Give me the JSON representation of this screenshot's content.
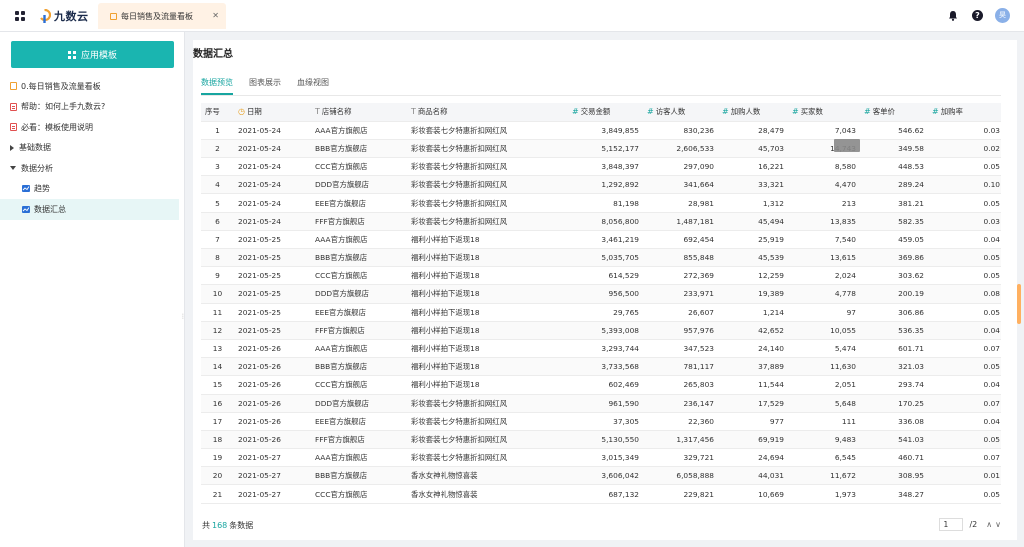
{
  "app": {
    "logo_text": "九数云",
    "tab_title": "每日销售及流量看板",
    "avatar_text": "昊"
  },
  "sidebar": {
    "app_button": "应用模板",
    "items": [
      {
        "label": "0.每日销售及流量看板"
      },
      {
        "label": "帮助：如何上手九数云?"
      },
      {
        "label": "必看：模板使用说明"
      },
      {
        "label": "基础数据"
      },
      {
        "label": "数据分析"
      },
      {
        "label": "趋势"
      },
      {
        "label": "数据汇总"
      }
    ]
  },
  "main": {
    "title": "数据汇总",
    "tabs": [
      "数据预览",
      "图表展示",
      "血缘视图"
    ],
    "columns": [
      "序号",
      "日期",
      "店铺名称",
      "商品名称",
      "交易金额",
      "访客人数",
      "加购人数",
      "买家数",
      "客单价",
      "加购率"
    ],
    "rows": [
      [
        "1",
        "2021-05-24",
        "AAA官方旗舰店",
        "彩妆套装七夕特惠折扣网红风",
        "3,849,855",
        "830,236",
        "28,479",
        "7,043",
        "546.62",
        "0.03"
      ],
      [
        "2",
        "2021-05-24",
        "BBB官方旗舰店",
        "彩妆套装七夕特惠折扣网红风",
        "5,152,177",
        "2,606,533",
        "45,703",
        "14,743",
        "349.58",
        "0.02"
      ],
      [
        "3",
        "2021-05-24",
        "CCC官方旗舰店",
        "彩妆套装七夕特惠折扣网红风",
        "3,848,397",
        "297,090",
        "16,221",
        "8,580",
        "448.53",
        "0.05"
      ],
      [
        "4",
        "2021-05-24",
        "DDD官方旗舰店",
        "彩妆套装七夕特惠折扣网红风",
        "1,292,892",
        "341,664",
        "33,321",
        "4,470",
        "289.24",
        "0.10"
      ],
      [
        "5",
        "2021-05-24",
        "EEE官方旗舰店",
        "彩妆套装七夕特惠折扣网红风",
        "81,198",
        "28,981",
        "1,312",
        "213",
        "381.21",
        "0.05"
      ],
      [
        "6",
        "2021-05-24",
        "FFF官方旗舰店",
        "彩妆套装七夕特惠折扣网红风",
        "8,056,800",
        "1,487,181",
        "45,494",
        "13,835",
        "582.35",
        "0.03"
      ],
      [
        "7",
        "2021-05-25",
        "AAA官方旗舰店",
        "福利小样拍下返现18",
        "3,461,219",
        "692,454",
        "25,919",
        "7,540",
        "459.05",
        "0.04"
      ],
      [
        "8",
        "2021-05-25",
        "BBB官方旗舰店",
        "福利小样拍下返现18",
        "5,035,705",
        "855,848",
        "45,539",
        "13,615",
        "369.86",
        "0.05"
      ],
      [
        "9",
        "2021-05-25",
        "CCC官方旗舰店",
        "福利小样拍下返现18",
        "614,529",
        "272,369",
        "12,259",
        "2,024",
        "303.62",
        "0.05"
      ],
      [
        "10",
        "2021-05-25",
        "DDD官方旗舰店",
        "福利小样拍下返现18",
        "956,500",
        "233,971",
        "19,389",
        "4,778",
        "200.19",
        "0.08"
      ],
      [
        "11",
        "2021-05-25",
        "EEE官方旗舰店",
        "福利小样拍下返现18",
        "29,765",
        "26,607",
        "1,214",
        "97",
        "306.86",
        "0.05"
      ],
      [
        "12",
        "2021-05-25",
        "FFF官方旗舰店",
        "福利小样拍下返现18",
        "5,393,008",
        "957,976",
        "42,652",
        "10,055",
        "536.35",
        "0.04"
      ],
      [
        "13",
        "2021-05-26",
        "AAA官方旗舰店",
        "福利小样拍下返现18",
        "3,293,744",
        "347,523",
        "24,140",
        "5,474",
        "601.71",
        "0.07"
      ],
      [
        "14",
        "2021-05-26",
        "BBB官方旗舰店",
        "福利小样拍下返现18",
        "3,733,568",
        "781,117",
        "37,889",
        "11,630",
        "321.03",
        "0.05"
      ],
      [
        "15",
        "2021-05-26",
        "CCC官方旗舰店",
        "福利小样拍下返现18",
        "602,469",
        "265,803",
        "11,544",
        "2,051",
        "293.74",
        "0.04"
      ],
      [
        "16",
        "2021-05-26",
        "DDD官方旗舰店",
        "彩妆套装七夕特惠折扣网红风",
        "961,590",
        "236,147",
        "17,529",
        "5,648",
        "170.25",
        "0.07"
      ],
      [
        "17",
        "2021-05-26",
        "EEE官方旗舰店",
        "彩妆套装七夕特惠折扣网红风",
        "37,305",
        "22,360",
        "977",
        "111",
        "336.08",
        "0.04"
      ],
      [
        "18",
        "2021-05-26",
        "FFF官方旗舰店",
        "彩妆套装七夕特惠折扣网红风",
        "5,130,550",
        "1,317,456",
        "69,919",
        "9,483",
        "541.03",
        "0.05"
      ],
      [
        "19",
        "2021-05-27",
        "AAA官方旗舰店",
        "彩妆套装七夕特惠折扣网红风",
        "3,015,349",
        "329,721",
        "24,694",
        "6,545",
        "460.71",
        "0.07"
      ],
      [
        "20",
        "2021-05-27",
        "BBB官方旗舰店",
        "香水女神礼物惊喜装",
        "3,606,042",
        "6,058,888",
        "44,031",
        "11,672",
        "308.95",
        "0.01"
      ],
      [
        "21",
        "2021-05-27",
        "CCC官方旗舰店",
        "香水女神礼物惊喜装",
        "687,132",
        "229,821",
        "10,669",
        "1,973",
        "348.27",
        "0.05"
      ]
    ]
  },
  "footer": {
    "total_prefix": "共",
    "total_count": "168",
    "total_suffix": "条数据",
    "current_page": "1",
    "total_pages": "/2"
  }
}
